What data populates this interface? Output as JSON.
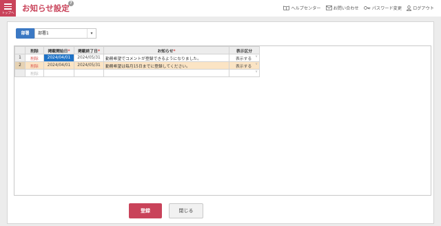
{
  "header": {
    "menu_label": "トップへ",
    "title": "お知らせ設定",
    "help_mark": "?",
    "links": {
      "help_center": "ヘルプセンター",
      "contact": "お問い合わせ",
      "password": "パスワード変更",
      "logout": "ログアウト"
    }
  },
  "department": {
    "label": "部署",
    "value": "部署1",
    "arrow": "▾"
  },
  "grid": {
    "headers": {
      "delete": "削除",
      "start": "掲載開始日",
      "end": "掲載終了日",
      "notice": "お知らせ",
      "display": "表示区分"
    },
    "required_mark": "*",
    "rows": [
      {
        "num": "1",
        "delete": "削除",
        "start": "2024/04/01",
        "end": "2024/05/31",
        "notice": "勤務希望でコメントが登録できるようになりました。",
        "display": "表示する"
      },
      {
        "num": "2",
        "delete": "削除",
        "start": "2024/04/01",
        "end": "2024/05/31",
        "notice": "勤務希望は毎月15日までに登録してください。",
        "display": "表示する"
      },
      {
        "num": "",
        "delete": "削除",
        "start": "",
        "end": "",
        "notice": "",
        "display": ""
      }
    ],
    "dropdown_mark": "∨"
  },
  "buttons": {
    "submit": "登録",
    "close": "閉じる"
  },
  "colors": {
    "accent": "#c9435a",
    "blue": "#3b78c3",
    "selected_row": "#fbe4c4"
  }
}
